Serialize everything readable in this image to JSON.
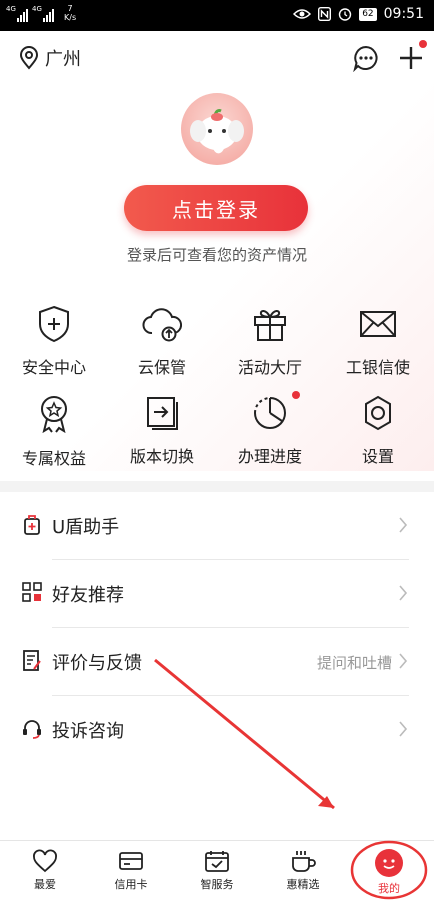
{
  "status_bar": {
    "network_1": "4G",
    "network_2": "4G",
    "speed_value": "7",
    "speed_unit": "K/s",
    "battery": "62",
    "time": "09:51"
  },
  "header": {
    "location": "广州",
    "login_button": "点击登录",
    "login_tip": "登录后可查看您的资产情况"
  },
  "grid": [
    {
      "label": "安全中心",
      "icon": "shield-plus-icon"
    },
    {
      "label": "云保管",
      "icon": "cloud-upload-icon"
    },
    {
      "label": "活动大厅",
      "icon": "gift-icon"
    },
    {
      "label": "工银信使",
      "icon": "envelope-icon"
    },
    {
      "label": "专属权益",
      "icon": "award-badge-icon"
    },
    {
      "label": "版本切换",
      "icon": "switch-version-icon"
    },
    {
      "label": "办理进度",
      "icon": "progress-pie-icon"
    },
    {
      "label": "设置",
      "icon": "gear-icon"
    }
  ],
  "menu": [
    {
      "label": "U盾助手",
      "right": "",
      "icon": "usb-key-icon"
    },
    {
      "label": "好友推荐",
      "right": "",
      "icon": "qr-code-icon"
    },
    {
      "label": "评价与反馈",
      "right": "提问和吐槽",
      "icon": "feedback-icon"
    },
    {
      "label": "投诉咨询",
      "right": "",
      "icon": "headset-icon"
    }
  ],
  "tabs": [
    {
      "label": "最爱",
      "icon": "heart-icon"
    },
    {
      "label": "信用卡",
      "icon": "credit-card-icon"
    },
    {
      "label": "智服务",
      "icon": "calendar-check-icon"
    },
    {
      "label": "惠精选",
      "icon": "cup-icon"
    },
    {
      "label": "我的",
      "icon": "me-icon",
      "active": true
    }
  ],
  "colors": {
    "accent": "#e8323a",
    "annotation": "#e83535"
  }
}
